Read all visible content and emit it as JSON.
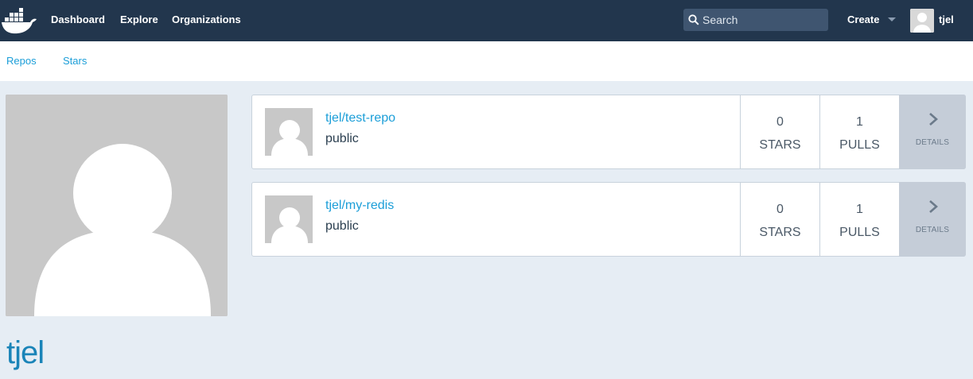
{
  "topnav": {
    "links": [
      "Dashboard",
      "Explore",
      "Organizations"
    ],
    "search_placeholder": "Search",
    "create_label": "Create",
    "username": "tjel"
  },
  "subnav": {
    "links": [
      "Repos",
      "Stars"
    ]
  },
  "profile": {
    "name": "tjel"
  },
  "repos": [
    {
      "name": "tjel/test-repo",
      "visibility": "public",
      "stars": "0",
      "stars_label": "STARS",
      "pulls": "1",
      "pulls_label": "PULLS",
      "details_label": "DETAILS"
    },
    {
      "name": "tjel/my-redis",
      "visibility": "public",
      "stars": "0",
      "stars_label": "STARS",
      "pulls": "1",
      "pulls_label": "PULLS",
      "details_label": "DETAILS"
    }
  ],
  "colors": {
    "nav_bg": "#22364d",
    "link": "#1b9ed8",
    "page_bg": "#e6edf4",
    "details_bg": "#c5cdd8"
  }
}
